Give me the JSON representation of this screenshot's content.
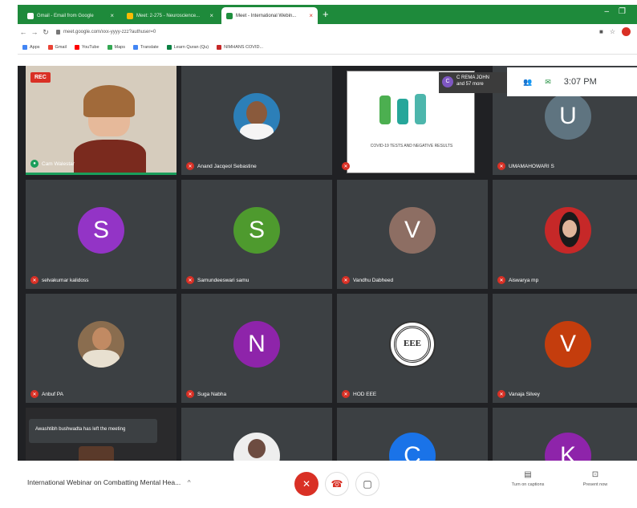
{
  "browser": {
    "tabs": [
      {
        "label": "Gmail - Email from Google",
        "color": "#e8f5e9"
      },
      {
        "label": "Meet: 2-275 - Neuroscience...",
        "color": "#fbbc04"
      },
      {
        "label": "Meet - International Webin...",
        "color": "#1e8e3e"
      }
    ],
    "new_tab": "+",
    "window_controls": [
      "–",
      "❐"
    ],
    "url": "meet.google.com/xxx-yyyy-zzz?authuser=0",
    "bookmarks": [
      "Apps",
      "Gmail",
      "YouTube",
      "Maps",
      "Translate",
      "Learn Quran (Qu)",
      "NIMHANS COVID..."
    ]
  },
  "meet": {
    "rec_label": "REC",
    "time": "3:07 PM",
    "presenter": {
      "initial": "C",
      "line1": "C REMA JOHN",
      "line2": "and 57 more"
    },
    "present_slide_caption": "COVID-19 TESTS AND NEGATIVE RESULTS",
    "toast": "Awashtibh bushwadta has left the meeting",
    "tiles": [
      {
        "name": "Cam Walestar",
        "type": "photo-woman"
      },
      {
        "name": "Anand Jacqeol Sebastine",
        "type": "photo-man"
      },
      {
        "name": "",
        "type": "present"
      },
      {
        "name": "UMAMAHOWARI S",
        "type": "avatar",
        "initial": "U",
        "color": "#5f7480"
      },
      {
        "name": "selvakumar kalidoss",
        "type": "avatar",
        "initial": "S",
        "color": "#9334c6"
      },
      {
        "name": "Samundeeswari samu",
        "type": "avatar",
        "initial": "S",
        "color": "#4e9a2e"
      },
      {
        "name": "Vandhu Dabheed",
        "type": "avatar",
        "initial": "V",
        "color": "#8d6e63"
      },
      {
        "name": "Aiswarya mp",
        "type": "photo-red"
      },
      {
        "name": "Anbuf PA",
        "type": "photo-man2"
      },
      {
        "name": "Suga Nabha",
        "type": "avatar",
        "initial": "N",
        "color": "#8e24aa"
      },
      {
        "name": "HOD EEE",
        "type": "logo"
      },
      {
        "name": "Vanaja Silvey",
        "type": "avatar",
        "initial": "V",
        "color": "#c43d0d"
      },
      {
        "name": "",
        "type": "hidden"
      },
      {
        "name": "",
        "type": "photo-child"
      },
      {
        "name": "",
        "type": "avatar",
        "initial": "C",
        "color": "#1a73e8"
      },
      {
        "name": "",
        "type": "avatar",
        "initial": "K",
        "color": "#8e24aa"
      }
    ]
  },
  "controls": {
    "meeting_title": "International Webinar on Combatting Mental Hea...",
    "chevron": "^",
    "captions_label": "Turn on captions",
    "present_label": "Present now"
  },
  "colors": {
    "accent_green": "#1e8a3b",
    "meet_bg": "#202124",
    "mute_red": "#d93025"
  }
}
